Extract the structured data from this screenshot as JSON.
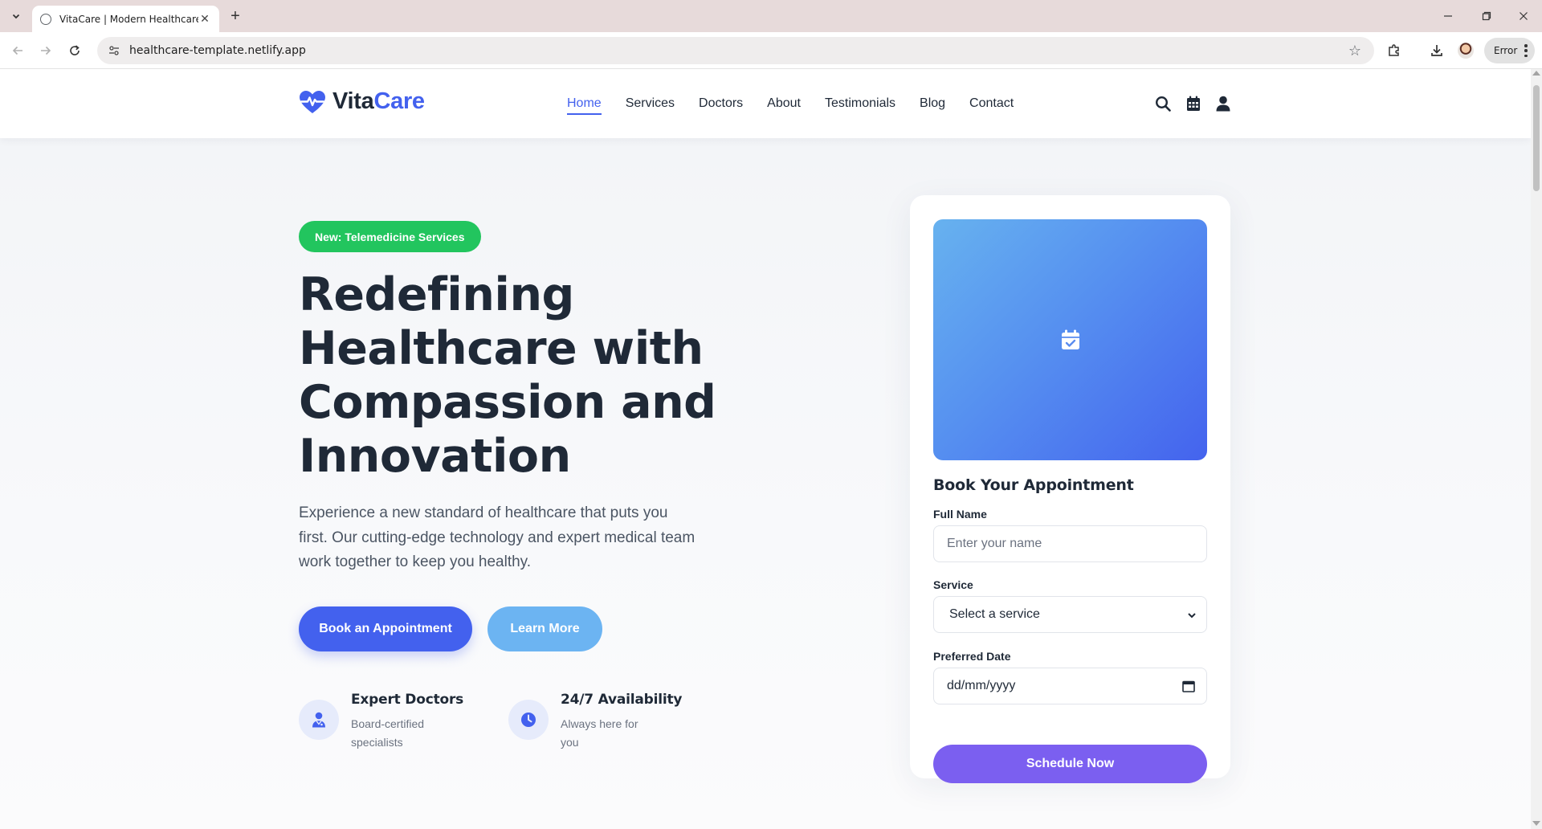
{
  "browser": {
    "tab_title": "VitaCare | Modern Healthcare S",
    "url": "healthcare-template.netlify.app",
    "profile_status": "Error"
  },
  "header": {
    "logo_part1": "Vita",
    "logo_part2": "Care",
    "nav": [
      "Home",
      "Services",
      "Doctors",
      "About",
      "Testimonials",
      "Blog",
      "Contact"
    ],
    "active_nav": "Home",
    "accent_color": "#4361ee"
  },
  "hero": {
    "badge": "New: Telemedicine Services",
    "badge_color": "#22c55e",
    "title": "Redefining Healthcare with Compassion and Innovation",
    "description": "Experience a new standard of healthcare that puts you first. Our cutting-edge technology and expert medical team work together to keep you healthy.",
    "primary_button": "Book an Appointment",
    "secondary_button": "Learn More",
    "features": [
      {
        "title": "Expert Doctors",
        "subtitle": "Board-certified specialists",
        "icon": "user-doctor-icon"
      },
      {
        "title": "24/7 Availability",
        "subtitle": "Always here for you",
        "icon": "clock-icon"
      }
    ]
  },
  "booking": {
    "title": "Book Your Appointment",
    "name_label": "Full Name",
    "name_placeholder": "Enter your name",
    "service_label": "Service",
    "service_value": "Select a service",
    "date_label": "Preferred Date",
    "date_placeholder": "dd/mm/yyyy",
    "submit": "Schedule Now",
    "submit_color": "#7b5ff0"
  }
}
